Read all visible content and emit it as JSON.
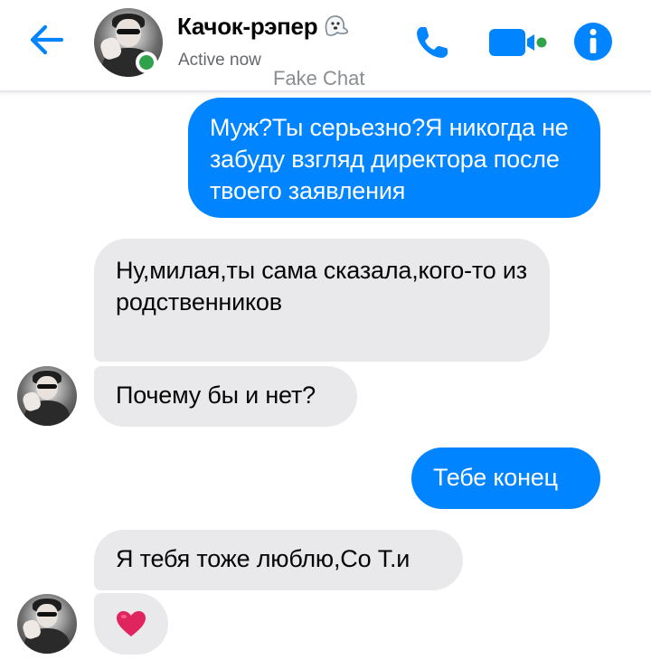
{
  "header": {
    "contact_name": "Качок-рэпер",
    "status": "Active now",
    "watermark": "Fake Chat",
    "icons": {
      "back": "back-arrow-icon",
      "phone": "phone-icon",
      "video": "video-camera-icon",
      "info": "info-icon",
      "name_emoji": "ghost-icon"
    }
  },
  "colors": {
    "accent": "#0084ff",
    "incoming_bubble": "#e9e9eb",
    "online": "#31a24c",
    "heart": "#e0245e"
  },
  "messages": [
    {
      "direction": "outgoing",
      "text": "Муж?Ты серьезно?Я никогда не забуду взгляд директора после твоего заявления"
    },
    {
      "direction": "incoming",
      "text": "Ну,милая,ты сама сказала,кого-то из родственников"
    },
    {
      "direction": "incoming",
      "text": "Почему бы и нет?"
    },
    {
      "direction": "outgoing",
      "text": "Тебе конец"
    },
    {
      "direction": "incoming",
      "text": "Я тебя тоже люблю,Со Т.и"
    },
    {
      "direction": "incoming",
      "text": "❤️"
    }
  ]
}
